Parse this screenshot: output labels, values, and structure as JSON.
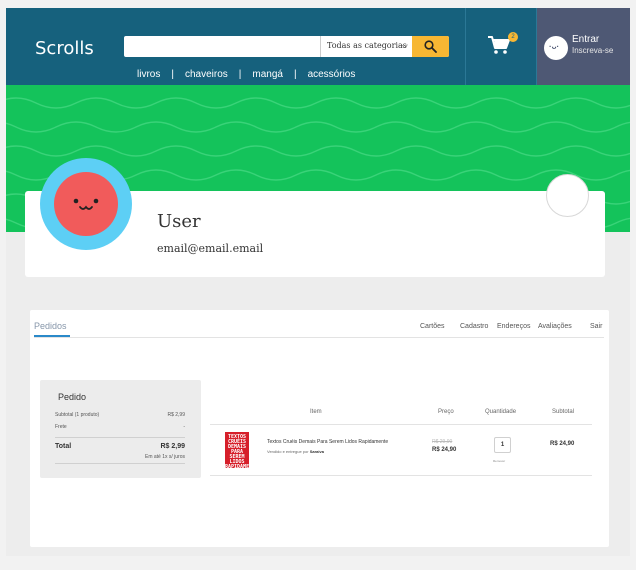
{
  "header": {
    "brand": "Scrolls",
    "search": {
      "value": "",
      "placeholder": ""
    },
    "category_select": "Todas as categorias",
    "cart_count": "2",
    "login": {
      "line1": "Entrar",
      "line2": "Inscreva-se",
      "avatar_face": "·ᴗ·"
    },
    "nav": [
      "livros",
      "chaveiros",
      "mangá",
      "acessórios"
    ],
    "separator": "|"
  },
  "profile": {
    "name": "User",
    "email": "email@email.email"
  },
  "orders": {
    "active_tab": "Pedidos",
    "tabs": [
      "Cartões",
      "Cadastro",
      "Endereços",
      "Avaliações",
      "Sair"
    ],
    "summary": {
      "title": "Pedido",
      "subtotal_label": "Subtotal (1 produto)",
      "subtotal_value": "R$ 2,99",
      "shipping_label": "Frete",
      "shipping_value": "-",
      "total_label": "Total",
      "total_value": "R$ 2,99",
      "installments": "Em até 1x s/ juros"
    },
    "columns": {
      "item": "Item",
      "price": "Preço",
      "quantity": "Quantidade",
      "subtotal": "Subtotal"
    },
    "items": [
      {
        "cover_text": "TEXTOS CRUÉIS DEMAIS PARA SEREM LIDOS RAPIDAMENTE",
        "title": "Textos Cruéis Demais Para Serem Lidos Rapidamente",
        "seller_prefix": "Vendido e entregue por",
        "seller": "Saraiva",
        "price_old": "R$ 29,90",
        "price_new": "R$ 24,90",
        "quantity": "1",
        "remove": "Remover",
        "subtotal": "R$ 24,90"
      }
    ]
  },
  "colors": {
    "header": "#16617d",
    "banner": "#14c35b",
    "accent": "#f7b733",
    "avatar_ring": "#5dcff5",
    "avatar_face": "#f15b5b",
    "login_bg": "#4e5874"
  }
}
